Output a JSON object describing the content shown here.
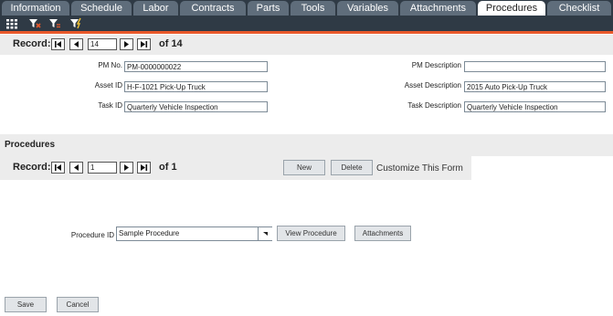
{
  "tabs": [
    "Information",
    "Schedule",
    "Labor",
    "Contracts",
    "Parts",
    "Tools",
    "Variables",
    "Attachments",
    "Procedures",
    "Checklist"
  ],
  "active_tab": "Procedures",
  "toolbar_icons": [
    "grid-icon",
    "clear-filter-icon",
    "filter-icon",
    "apply-filter-icon"
  ],
  "record_nav": {
    "label": "Record:",
    "current": "14",
    "total": "of 14"
  },
  "form": {
    "pm_no_label": "PM No.",
    "pm_no_value": "PM-0000000022",
    "asset_id_label": "Asset ID",
    "asset_id_value": "H-F-1021 Pick-Up Truck",
    "task_id_label": "Task ID",
    "task_id_value": "Quarterly Vehicle Inspection",
    "pm_description_label": "PM Description",
    "pm_description_value": "",
    "asset_description_label": "Asset Description",
    "asset_description_value": "2015 Auto Pick-Up Truck",
    "task_description_label": "Task Description",
    "task_description_value": "Quarterly Vehicle Inspection"
  },
  "procedures": {
    "title": "Procedures",
    "record_label": "Record:",
    "record_current": "1",
    "record_total": "of 1",
    "new_label": "New",
    "delete_label": "Delete",
    "customize_label": "Customize This Form",
    "procedure_id_label": "Procedure ID",
    "procedure_id_value": "Sample Procedure",
    "view_procedure_label": "View Procedure",
    "attachments_label": "Attachments"
  },
  "footer": {
    "save_label": "Save",
    "cancel_label": "Cancel"
  }
}
